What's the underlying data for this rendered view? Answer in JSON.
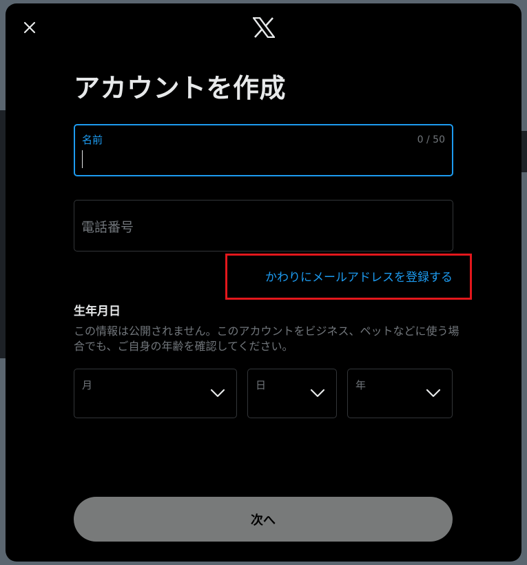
{
  "header": {
    "close_icon": "close-icon",
    "logo_icon": "x-logo-icon"
  },
  "title": "アカウントを作成",
  "name_field": {
    "label": "名前",
    "counter": "0 / 50",
    "value": ""
  },
  "phone_field": {
    "placeholder": "電話番号"
  },
  "email_link": "かわりにメールアドレスを登録する",
  "dob": {
    "title": "生年月日",
    "description": "この情報は公開されません。このアカウントをビジネス、ペットなどに使う場合でも、ご自身の年齢を確認してください。",
    "month_label": "月",
    "day_label": "日",
    "year_label": "年"
  },
  "next_button": "次へ",
  "colors": {
    "accent": "#1d9bf0",
    "highlight": "#e3171c",
    "background": "#000000",
    "disabled_button": "#787a7a"
  }
}
